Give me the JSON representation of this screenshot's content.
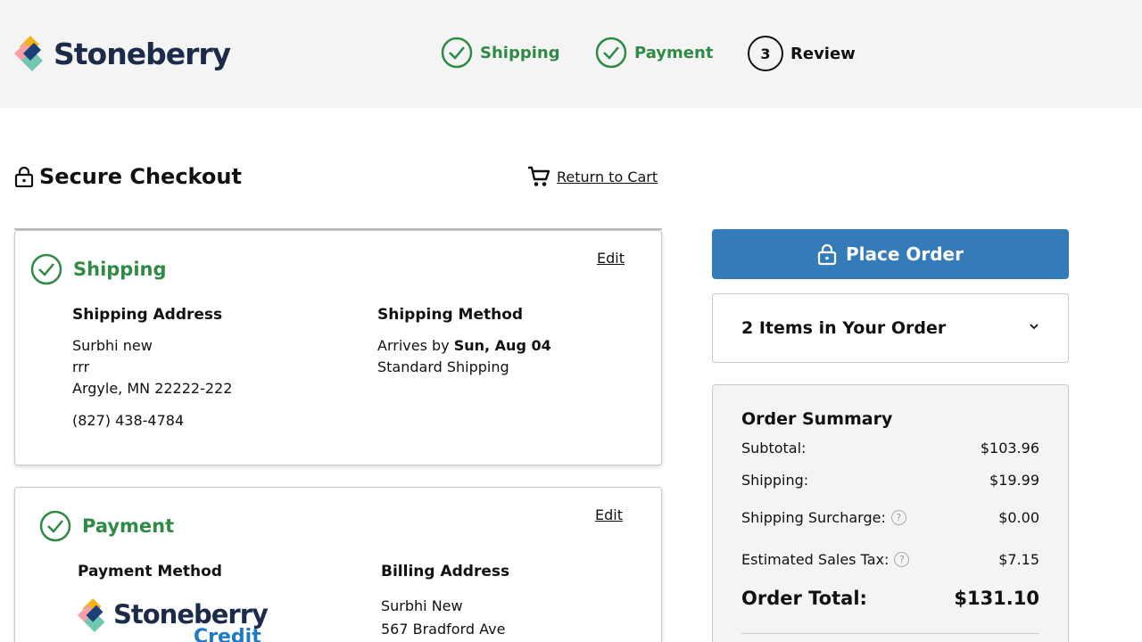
{
  "brand": {
    "name": "Stoneberry",
    "credit_name": "Stoneberry",
    "credit_sub": "Credit"
  },
  "steps": [
    {
      "label": "Shipping",
      "status": "done"
    },
    {
      "label": "Payment",
      "status": "done"
    },
    {
      "number": "3",
      "label": "Review",
      "status": "current"
    }
  ],
  "checkout": {
    "title": "Secure Checkout",
    "return_to_cart": "Return to Cart"
  },
  "shipping": {
    "title": "Shipping",
    "edit": "Edit",
    "address_heading": "Shipping Address",
    "address_lines": [
      "Surbhi new",
      "rrr",
      "Argyle, MN 22222-222"
    ],
    "phone": "(827) 438-4784",
    "method_heading": "Shipping Method",
    "arrives_prefix": "Arrives by",
    "arrives_date": "Sun, Aug 04",
    "method_name": "Standard Shipping"
  },
  "payment": {
    "title": "Payment",
    "edit": "Edit",
    "method_heading": "Payment Method",
    "billing_heading": "Billing Address",
    "billing_lines": [
      "Surbhi New",
      "567 Bradford Ave"
    ]
  },
  "order": {
    "place_order": "Place Order",
    "items_label": "2 Items in Your Order",
    "summary_title": "Order Summary",
    "subtotal_label": "Subtotal:",
    "subtotal": "$103.96",
    "shipping_label": "Shipping:",
    "shipping": "$19.99",
    "surcharge_label": "Shipping Surcharge:",
    "surcharge": "$0.00",
    "tax_label": "Estimated Sales Tax:",
    "tax": "$7.15",
    "total_label": "Order Total:",
    "total": "$131.10"
  },
  "colors": {
    "accent_green": "#2f8a45",
    "button_blue": "#347bba",
    "brand_navy": "#1c2b4a"
  }
}
